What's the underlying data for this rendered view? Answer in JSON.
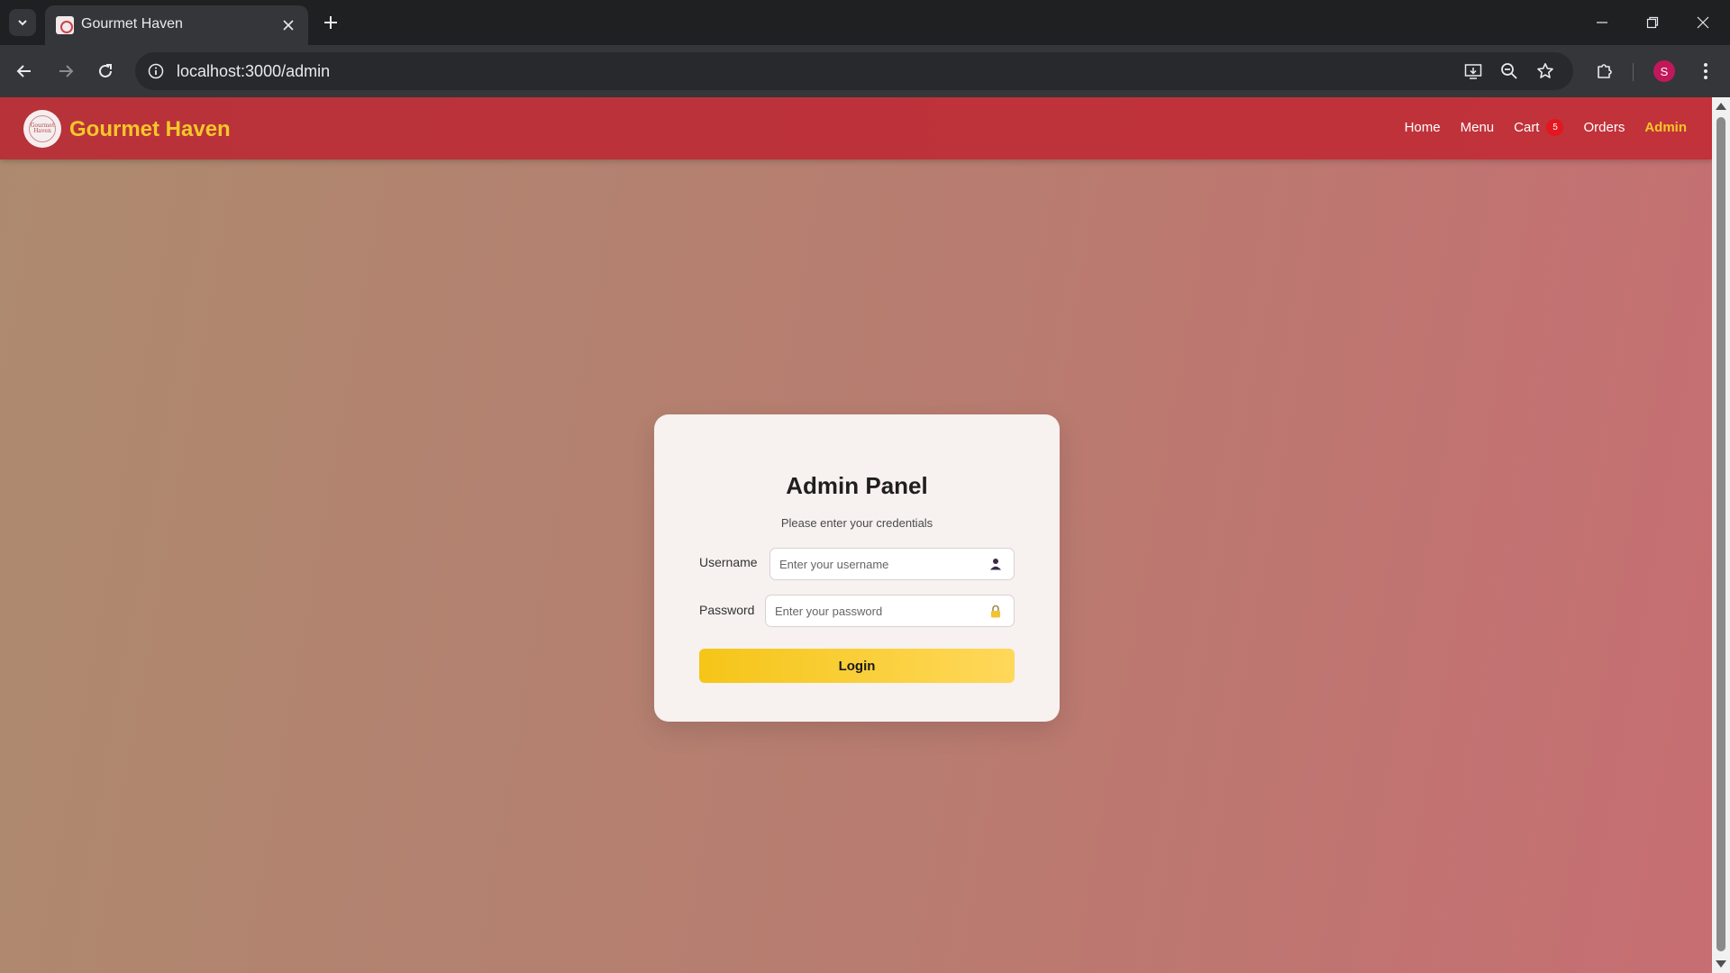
{
  "browser": {
    "tab": {
      "title": "Gourmet Haven"
    },
    "address": {
      "url": "localhost:3000/admin"
    },
    "profile": {
      "initial": "S"
    }
  },
  "site": {
    "brand": "Gourmet Haven",
    "logo_text": "Gourmet Haven",
    "nav": {
      "home": "Home",
      "menu": "Menu",
      "cart": "Cart",
      "cart_count": "5",
      "orders": "Orders",
      "admin": "Admin"
    }
  },
  "login": {
    "title": "Admin Panel",
    "subtitle": "Please enter your credentials",
    "username_label": "Username",
    "username_placeholder": "Enter your username",
    "password_label": "Password",
    "password_placeholder": "Enter your password",
    "submit_label": "Login"
  },
  "colors": {
    "header_red": "#bd323a",
    "brand_yellow": "#f6c728",
    "badge_red": "#e4161f",
    "button_yellow": "#f5c518"
  }
}
